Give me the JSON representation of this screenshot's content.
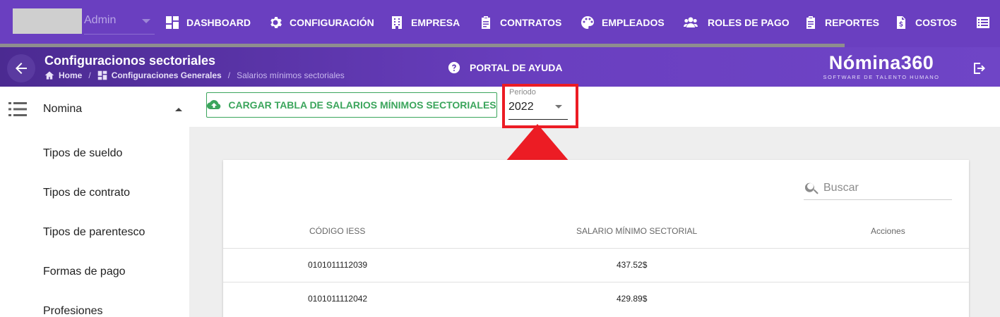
{
  "topnav": {
    "user_name": "Admin",
    "items": [
      {
        "label": "DASHBOARD",
        "icon": "dashboard-icon"
      },
      {
        "label": "CONFIGURACIÓN",
        "icon": "gear-icon"
      },
      {
        "label": "EMPRESA",
        "icon": "building-icon"
      },
      {
        "label": "CONTRATOS",
        "icon": "clipboard-icon"
      },
      {
        "label": "EMPLEADOS",
        "icon": "palette-icon"
      },
      {
        "label": "ROLES DE PAGO",
        "icon": "users-icon"
      },
      {
        "label": "REPORTES",
        "icon": "clipboard-icon"
      },
      {
        "label": "COSTOS",
        "icon": "invoice-dollar-icon"
      }
    ],
    "colors": {
      "primary": "#6a3fc0",
      "accent_dark": "#4b2a91"
    }
  },
  "header": {
    "title": "Configuracionos sectoriales",
    "breadcrumb": {
      "home": "Home",
      "section": "Configuraciones Generales",
      "current": "Salarios mínimos sectoriales"
    },
    "help": "PORTAL DE AYUDA",
    "brand_name": "Nómina360",
    "brand_tagline": "SOFTWARE DE TALENTO HUMANO"
  },
  "sidebar": {
    "group": "Nomina",
    "items": [
      "Tipos de sueldo",
      "Tipos de contrato",
      "Tipos de parentesco",
      "Formas de pago",
      "Profesiones"
    ]
  },
  "toolbar": {
    "upload_label": "CARGAR TABLA DE SALARIOS MÍNIMOS SECTORIALES",
    "period_label": "Periodo",
    "period_value": "2022",
    "highlight_color": "#ec1c24",
    "success_color": "#3ba55c"
  },
  "table": {
    "search_placeholder": "Buscar",
    "columns": [
      "CÓDIGO IESS",
      "SALARIO MÍNIMO SECTORIAL",
      "Acciones"
    ],
    "rows": [
      {
        "code": "0101011112039",
        "salary": "437.52$"
      },
      {
        "code": "0101011112042",
        "salary": "429.89$"
      }
    ]
  }
}
